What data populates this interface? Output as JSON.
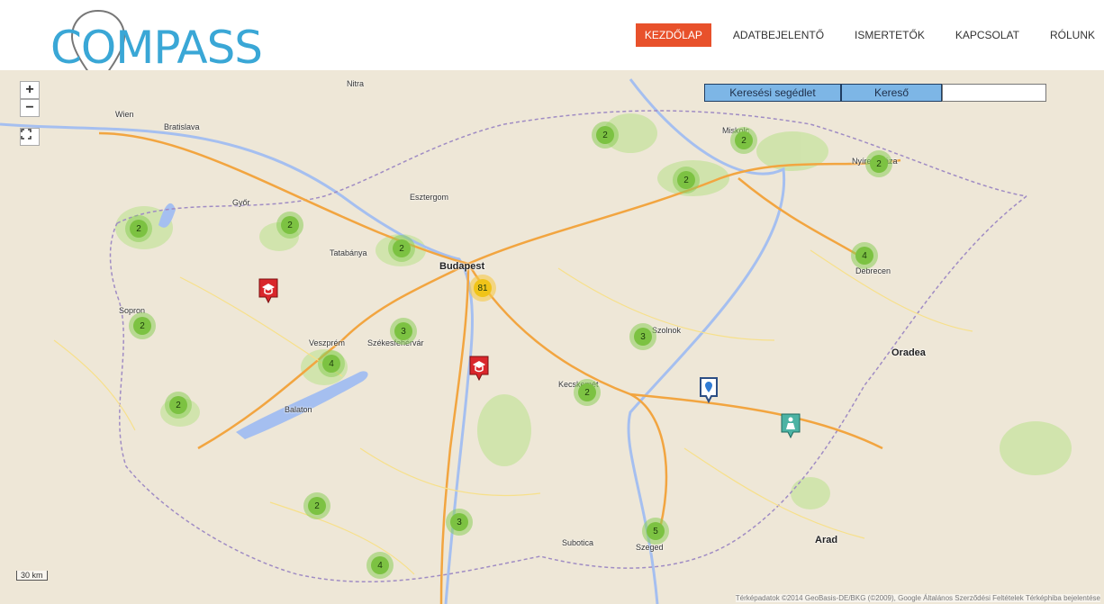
{
  "logo": {
    "text": "COMPASS"
  },
  "nav": [
    {
      "label": "KEZDŐLAP",
      "active": true
    },
    {
      "label": "ADATBEJELENTŐ",
      "active": false
    },
    {
      "label": "ISMERTETŐK",
      "active": false
    },
    {
      "label": "KAPCSOLAT",
      "active": false
    },
    {
      "label": "RÓLUNK",
      "active": false
    }
  ],
  "map": {
    "zoom_in": "+",
    "zoom_out": "−",
    "fullscreen_icon": "fullscreen-icon",
    "search_help_label": "Keresési segédlet",
    "search_label": "Kereső",
    "search_value": "",
    "scale_label": "30 km",
    "attribution": "Térképadatok ©2014 GeoBasis-DE/BKG (©2009), Google   Általános Szerződési Feltételek   Térképhiba bejelentése"
  },
  "clusters": [
    {
      "count": "2",
      "big": false
    },
    {
      "count": "2",
      "big": false
    },
    {
      "count": "2",
      "big": false
    },
    {
      "count": "2",
      "big": false
    },
    {
      "count": "2",
      "big": false
    },
    {
      "count": "2",
      "big": false
    },
    {
      "count": "2",
      "big": false
    },
    {
      "count": "4",
      "big": false
    },
    {
      "count": "2",
      "big": false
    },
    {
      "count": "81",
      "big": true
    },
    {
      "count": "3",
      "big": false
    },
    {
      "count": "4",
      "big": false
    },
    {
      "count": "3",
      "big": false
    },
    {
      "count": "2",
      "big": false
    },
    {
      "count": "2",
      "big": false
    },
    {
      "count": "2",
      "big": false
    },
    {
      "count": "3",
      "big": false
    },
    {
      "count": "5",
      "big": false
    },
    {
      "count": "4",
      "big": false
    }
  ],
  "places": [
    "Wien",
    "Bratislava",
    "Budapest",
    "Debrecen",
    "Szeged",
    "Kecskemét",
    "Veszprém",
    "Székesfehérvár",
    "Győr",
    "Miskolc",
    "Nyíregyháza",
    "Oradea",
    "Arad",
    "Subotica",
    "Szolnok",
    "Tatabánya",
    "Esztergom",
    "Balaton",
    "Nitra",
    "Sopron"
  ],
  "colors": {
    "accent": "#e8512b",
    "logo": "#3aa7d6",
    "search_button": "#7db6e6",
    "cluster": "#7cc242",
    "cluster_big": "#f0c419"
  }
}
